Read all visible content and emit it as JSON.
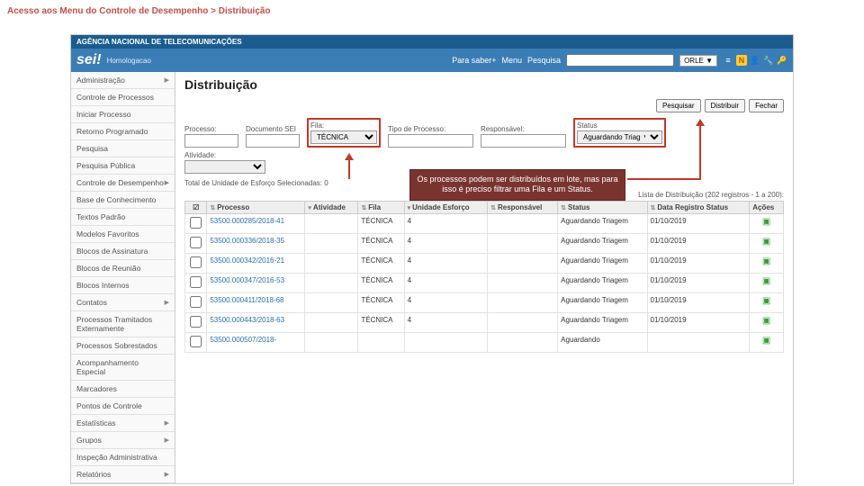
{
  "slide_title": "Acesso aos Menu do Controle de Desempenho > Distribuição",
  "agency": "AGÊNCIA NACIONAL DE TELECOMUNICAÇÕES",
  "logo": "sei!",
  "env": "Homologacao",
  "header": {
    "para_saber": "Para saber+",
    "menu": "Menu",
    "pesquisa": "Pesquisa",
    "unit": "ORLE ▼"
  },
  "sidebar": [
    {
      "label": "Administração",
      "sub": true
    },
    {
      "label": "Controle de Processos"
    },
    {
      "label": "Iniciar Processo"
    },
    {
      "label": "Retorno Programado"
    },
    {
      "label": "Pesquisa"
    },
    {
      "label": "Pesquisa Pública"
    },
    {
      "label": "Controle de Desempenho",
      "sub": true
    },
    {
      "label": "Base de Conhecimento"
    },
    {
      "label": "Textos Padrão"
    },
    {
      "label": "Modelos Favoritos"
    },
    {
      "label": "Blocos de Assinatura"
    },
    {
      "label": "Blocos de Reunião"
    },
    {
      "label": "Blocos Internos"
    },
    {
      "label": "Contatos",
      "sub": true
    },
    {
      "label": "Processos Tramitados Externamente"
    },
    {
      "label": "Processos Sobrestados"
    },
    {
      "label": "Acompanhamento Especial"
    },
    {
      "label": "Marcadores"
    },
    {
      "label": "Pontos de Controle"
    },
    {
      "label": "Estatísticas",
      "sub": true
    },
    {
      "label": "Grupos",
      "sub": true
    },
    {
      "label": "Inspeção Administrativa"
    },
    {
      "label": "Relatórios",
      "sub": true
    }
  ],
  "page": {
    "title": "Distribuição",
    "actions": {
      "pesquisar": "Pesquisar",
      "distribuir": "Distribuir",
      "fechar": "Fechar"
    },
    "filters": {
      "processo": "Processo:",
      "documento": "Documento SEI",
      "fila": "Fila:",
      "fila_value": "TÉCNICA",
      "tipo": "Tipo de Processo:",
      "responsavel": "Responsável:",
      "status": "Status",
      "status_value": "Aguardando Triag ▼",
      "atividade": "Atividade:"
    },
    "total": "Total de Unidade de Esforço Selecionadas: 0",
    "list_header": "Lista de Distribuição (202 registros - 1 a 200):",
    "callout": "Os processos podem ser distribuídos em lote, mas para isso é preciso filtrar uma Fila e um Status.",
    "columns": {
      "check": "☑",
      "processo": "Processo",
      "atividade": "Atividade",
      "fila": "Fila",
      "esforco": "Unidade Esforço",
      "responsavel": "Responsável",
      "status": "Status",
      "data": "Data Registro Status",
      "acoes": "Ações"
    },
    "rows": [
      {
        "proc": "53500.000285/2018-41",
        "fila": "TÉCNICA",
        "ue": "4",
        "status": "Aguardando Triagem",
        "data": "01/10/2019"
      },
      {
        "proc": "53500.000336/2018-35",
        "fila": "TÉCNICA",
        "ue": "4",
        "status": "Aguardando Triagem",
        "data": "01/10/2019"
      },
      {
        "proc": "53500.000342/2016-21",
        "fila": "TÉCNICA",
        "ue": "4",
        "status": "Aguardando Triagem",
        "data": "01/10/2019"
      },
      {
        "proc": "53500.000347/2016-53",
        "fila": "TÉCNICA",
        "ue": "4",
        "status": "Aguardando Triagem",
        "data": "01/10/2019"
      },
      {
        "proc": "53500.000411/2018-68",
        "fila": "TÉCNICA",
        "ue": "4",
        "status": "Aguardando Triagem",
        "data": "01/10/2019"
      },
      {
        "proc": "53500.000443/2018-63",
        "fila": "TÉCNICA",
        "ue": "4",
        "status": "Aguardando Triagem",
        "data": "01/10/2019"
      },
      {
        "proc": "53500.000507/2018-",
        "fila": "",
        "ue": "",
        "status": "Aguardando",
        "data": ""
      }
    ]
  }
}
